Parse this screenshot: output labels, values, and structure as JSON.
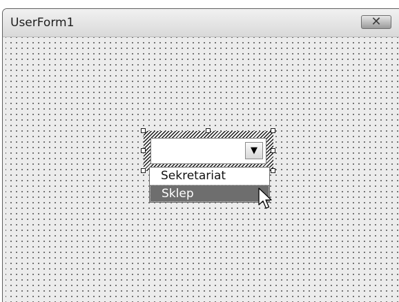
{
  "window": {
    "title": "UserForm1",
    "close_glyph": "✕"
  },
  "combo": {
    "arrow_glyph": "▼",
    "value": ""
  },
  "dropdown": {
    "items": [
      {
        "label": "Sekretariat",
        "selected": false
      },
      {
        "label": "Sklep",
        "selected": true
      }
    ]
  },
  "icons": {
    "close": "close-icon",
    "dropdown_arrow": "chevron-down-icon",
    "cursor": "mouse-pointer-icon"
  }
}
